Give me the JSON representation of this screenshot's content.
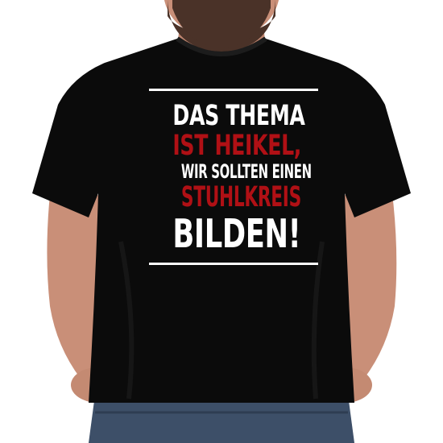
{
  "design": {
    "lines": [
      {
        "text": "DAS THEMA"
      },
      {
        "text": "IST HEIKEL,"
      },
      {
        "text": "WIR SOLLTEN EINEN"
      },
      {
        "text": "STUHLKREIS"
      },
      {
        "text": "BILDEN!"
      }
    ]
  },
  "colors": {
    "shirt": "#0b0b0b",
    "print_white": "#ffffff",
    "print_red": "#b01015",
    "skin": "#c98f78",
    "beard": "#4a3228",
    "jeans": "#3d4f68",
    "background": "#ffffff"
  }
}
